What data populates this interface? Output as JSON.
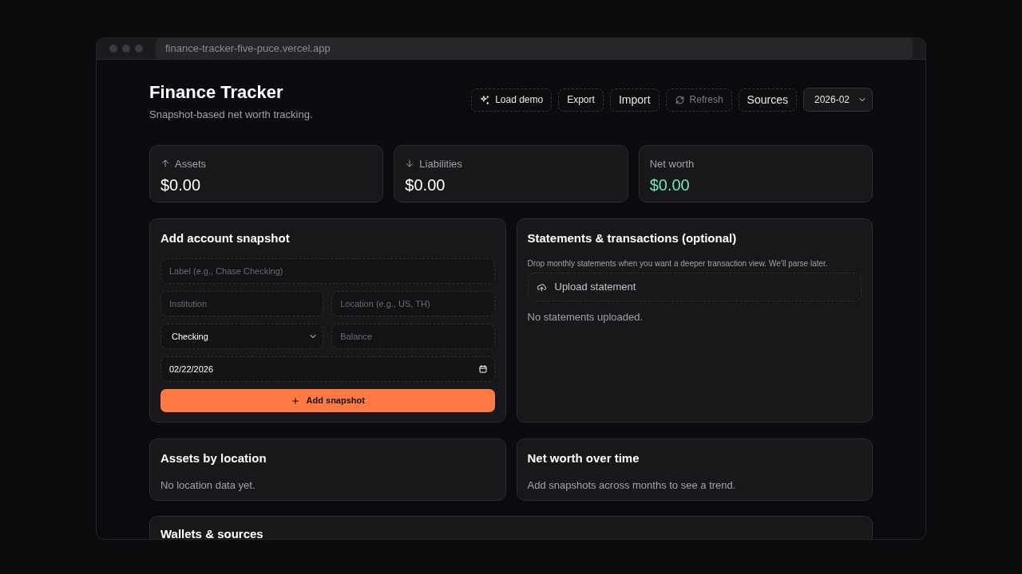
{
  "browser": {
    "url": "finance-tracker-five-puce.vercel.app"
  },
  "header": {
    "title": "Finance Tracker",
    "subtitle": "Snapshot-based net worth tracking."
  },
  "toolbar": {
    "buttons": [
      {
        "label": "Load demo",
        "disabled": false
      },
      {
        "label": "Export",
        "disabled": false
      },
      {
        "label": "Import",
        "disabled": false
      },
      {
        "label": "Refresh",
        "disabled": true
      },
      {
        "label": "Sources",
        "disabled": false
      }
    ],
    "month_select": {
      "value": "2026-02"
    }
  },
  "summary": [
    {
      "label": "Assets",
      "value": "$0.00",
      "positive": false
    },
    {
      "label": "Liabilities",
      "value": "$0.00",
      "positive": false
    },
    {
      "label": "Net worth",
      "value": "$0.00",
      "positive": true
    }
  ],
  "snapshot_form": {
    "title": "Add account snapshot",
    "label_field": {
      "placeholder": "Label (e.g., Chase Checking)"
    },
    "institution_field": {
      "placeholder": "Institution"
    },
    "location_field": {
      "placeholder": "Location (e.g., US, TH)"
    },
    "type_select": {
      "value": "Checking"
    },
    "balance_field": {
      "placeholder": "Balance"
    },
    "date_field": {
      "value": "02/22/2026"
    },
    "submit": "Add snapshot"
  },
  "statements": {
    "title": "Statements & transactions (optional)",
    "description": "Drop monthly statements when you want a deeper transaction view. We’ll parse later.",
    "upload": "Upload statement",
    "empty": "No statements uploaded."
  },
  "assets_by_location": {
    "title": "Assets by location",
    "empty": "No location data yet."
  },
  "net_worth_over_time": {
    "title": "Net worth over time",
    "empty": "Add snapshots across months to see a trend."
  },
  "wallets": {
    "title": "Wallets & sources"
  }
}
